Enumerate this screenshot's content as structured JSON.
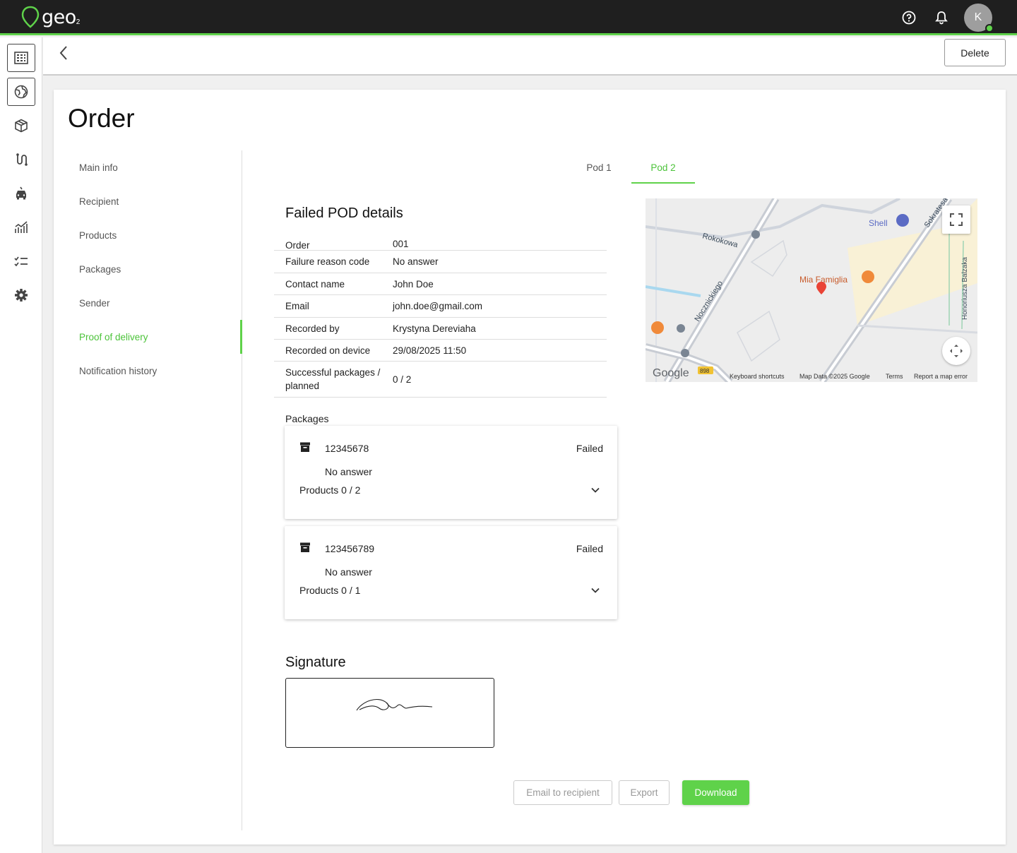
{
  "app": {
    "logo_text": "geo",
    "logo_sub": "2",
    "avatar_initial": "K"
  },
  "header": {
    "delete_label": "Delete"
  },
  "page": {
    "title": "Order"
  },
  "sidenav": {
    "items": [
      {
        "label": "Main info"
      },
      {
        "label": "Recipient"
      },
      {
        "label": "Products"
      },
      {
        "label": "Packages"
      },
      {
        "label": "Sender"
      },
      {
        "label": "Proof of delivery",
        "active": true
      },
      {
        "label": "Notification history"
      }
    ]
  },
  "tabs": [
    {
      "label": "Pod 1"
    },
    {
      "label": "Pod 2",
      "active": true
    }
  ],
  "pod": {
    "title": "Failed POD details",
    "rows": [
      {
        "key": "Order",
        "value": "001"
      },
      {
        "key": "Failure reason code",
        "value": "No answer"
      },
      {
        "key": "Contact name",
        "value": "John Doe"
      },
      {
        "key": "Email",
        "value": "john.doe@gmail.com"
      },
      {
        "key": "Recorded by",
        "value": "Krystyna Dereviaha"
      },
      {
        "key": "Recorded on device",
        "value": "29/08/2025 11:50"
      },
      {
        "key": "Successful packages / planned",
        "value": "0 / 2"
      }
    ],
    "packages_label": "Packages",
    "packages": [
      {
        "id": "12345678",
        "status": "Failed",
        "reason": "No answer",
        "products": "Products 0 / 2"
      },
      {
        "id": "123456789",
        "status": "Failed",
        "reason": "No answer",
        "products": "Products 0 / 1"
      }
    ],
    "signature_title": "Signature"
  },
  "map": {
    "streets": [
      "Rokokowa",
      "Nocznickiego",
      "Sokratesa",
      "Honoriusza Balzaka"
    ],
    "places": [
      "Shell",
      "Mia Famiglia"
    ],
    "road_number": "898",
    "google_label": "Google",
    "footer": [
      "Keyboard shortcuts",
      "Map Data ©2025 Google",
      "Terms",
      "Report a map error"
    ]
  },
  "actions": {
    "email_label": "Email to recipient",
    "export_label": "Export",
    "download_label": "Download"
  },
  "colors": {
    "accent": "#5fd24a",
    "topbar": "#1f1f1f"
  },
  "icons": {
    "rail": [
      "building-icon",
      "globe-icon",
      "package-icon",
      "route-icon",
      "vehicle-icon",
      "analytics-icon",
      "checklist-icon",
      "settings-icon"
    ]
  }
}
